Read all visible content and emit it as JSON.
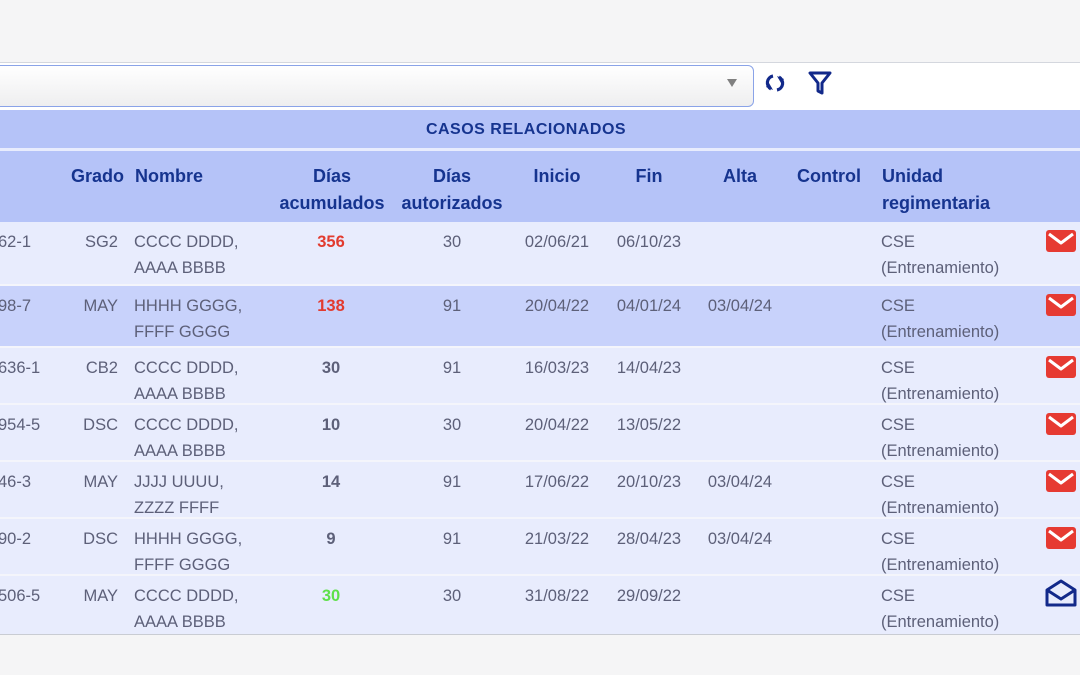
{
  "colors": {
    "header_bg": "#b5c3f8",
    "header_text": "#16348f",
    "row_bg": "#e8ecfd",
    "row_alt_bg": "#c8d2fb",
    "value_red": "#e23b2f",
    "value_green": "#5ee04a",
    "mail_red": "#e63a32",
    "mail_blue": "#12298a"
  },
  "toolbar": {
    "select_value": "",
    "refresh_icon": "refresh-icon",
    "filter_icon": "filter-icon"
  },
  "table": {
    "title": "CASOS RELACIONADOS",
    "headers": {
      "grado": "Grado",
      "nombre": "Nombre",
      "dias_acumulados_1": "Días",
      "dias_acumulados_2": "acumulados",
      "dias_autorizados_1": "Días",
      "dias_autorizados_2": "autorizados",
      "inicio": "Inicio",
      "fin": "Fin",
      "alta": "Alta",
      "control": "Control",
      "unidad_1": "Unidad",
      "unidad_2": "regimentaria"
    },
    "rows": [
      {
        "id": "62-1",
        "grado": "SG2",
        "nombre_1": "CCCC DDDD,",
        "nombre_2": "AAAA BBBB",
        "acumulados": "356",
        "acum_color": "red",
        "autorizados": "30",
        "inicio": "02/06/21",
        "fin": "06/10/23",
        "alta": "",
        "control": "",
        "unidad_1": "CSE",
        "unidad_2": "(Entrenamiento)",
        "mail_icon": "mail-closed-icon",
        "mail_state": "unread"
      },
      {
        "id": "98-7",
        "grado": "MAY",
        "nombre_1": "HHHH GGGG,",
        "nombre_2": "FFFF GGGG",
        "acumulados": "138",
        "acum_color": "red",
        "autorizados": "91",
        "inicio": "20/04/22",
        "fin": "04/01/24",
        "alta": "03/04/24",
        "control": "",
        "unidad_1": "CSE",
        "unidad_2": "(Entrenamiento)",
        "mail_icon": "mail-closed-icon",
        "mail_state": "unread"
      },
      {
        "id": "636-1",
        "grado": "CB2",
        "nombre_1": "CCCC DDDD,",
        "nombre_2": "AAAA BBBB",
        "acumulados": "30",
        "acum_color": "normal",
        "autorizados": "91",
        "inicio": "16/03/23",
        "fin": "14/04/23",
        "alta": "",
        "control": "",
        "unidad_1": "CSE",
        "unidad_2": "(Entrenamiento)",
        "mail_icon": "mail-closed-icon",
        "mail_state": "unread"
      },
      {
        "id": "954-5",
        "grado": "DSC",
        "nombre_1": "CCCC DDDD,",
        "nombre_2": "AAAA BBBB",
        "acumulados": "10",
        "acum_color": "normal",
        "autorizados": "30",
        "inicio": "20/04/22",
        "fin": "13/05/22",
        "alta": "",
        "control": "",
        "unidad_1": "CSE",
        "unidad_2": "(Entrenamiento)",
        "mail_icon": "mail-closed-icon",
        "mail_state": "unread"
      },
      {
        "id": "46-3",
        "grado": "MAY",
        "nombre_1": "JJJJ UUUU,",
        "nombre_2": "ZZZZ FFFF",
        "acumulados": "14",
        "acum_color": "normal",
        "autorizados": "91",
        "inicio": "17/06/22",
        "fin": "20/10/23",
        "alta": "03/04/24",
        "control": "",
        "unidad_1": "CSE",
        "unidad_2": "(Entrenamiento)",
        "mail_icon": "mail-closed-icon",
        "mail_state": "unread"
      },
      {
        "id": "90-2",
        "grado": "DSC",
        "nombre_1": "HHHH GGGG,",
        "nombre_2": "FFFF GGGG",
        "acumulados": "9",
        "acum_color": "normal",
        "autorizados": "91",
        "inicio": "21/03/22",
        "fin": "28/04/23",
        "alta": "03/04/24",
        "control": "",
        "unidad_1": "CSE",
        "unidad_2": "(Entrenamiento)",
        "mail_icon": "mail-closed-icon",
        "mail_state": "unread"
      },
      {
        "id": "506-5",
        "grado": "MAY",
        "nombre_1": "CCCC DDDD,",
        "nombre_2": "AAAA BBBB",
        "acumulados": "30",
        "acum_color": "green",
        "autorizados": "30",
        "inicio": "31/08/22",
        "fin": "29/09/22",
        "alta": "",
        "control": "",
        "unidad_1": "CSE",
        "unidad_2": "(Entrenamiento)",
        "mail_icon": "mail-open-icon",
        "mail_state": "read"
      }
    ]
  }
}
